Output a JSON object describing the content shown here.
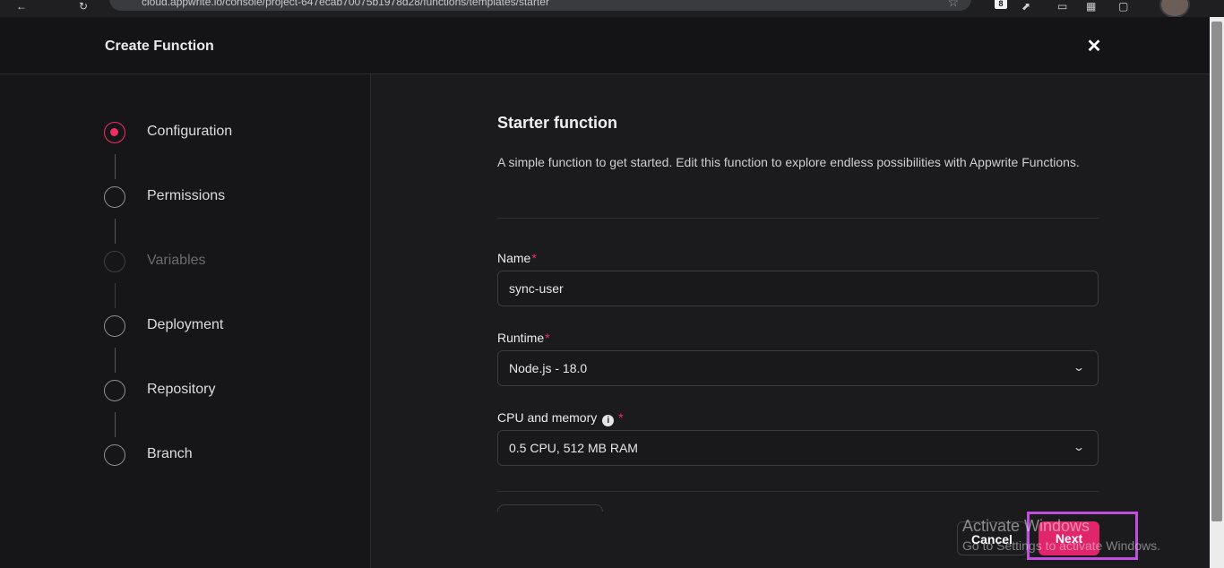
{
  "browser": {
    "url": "cloud.appwrite.io/console/project-647ecab70075b1978d28/functions/templates/starter",
    "badge": "8"
  },
  "modal": {
    "title": "Create Function"
  },
  "steps": [
    {
      "label": "Configuration",
      "state": "active"
    },
    {
      "label": "Permissions",
      "state": "pending"
    },
    {
      "label": "Variables",
      "state": "disabled"
    },
    {
      "label": "Deployment",
      "state": "pending"
    },
    {
      "label": "Repository",
      "state": "pending"
    },
    {
      "label": "Branch",
      "state": "pending"
    }
  ],
  "template": {
    "title": "Starter function",
    "description": "A simple function to get started. Edit this function to explore endless possibilities with Appwrite Functions."
  },
  "form": {
    "name_label": "Name",
    "name_value": "sync-user",
    "runtime_label": "Runtime",
    "runtime_value": "Node.js - 18.0",
    "cpu_label": "CPU and memory",
    "cpu_value": "0.5 CPU, 512 MB RAM",
    "required_mark": "*"
  },
  "footer": {
    "cancel_label": "Cancel",
    "next_label": "Next"
  },
  "watermark": {
    "title": "Activate Windows",
    "subtitle": "Go to Settings to activate Windows."
  },
  "colors": {
    "accent": "#f02e65",
    "highlight": "#c24ee0"
  }
}
